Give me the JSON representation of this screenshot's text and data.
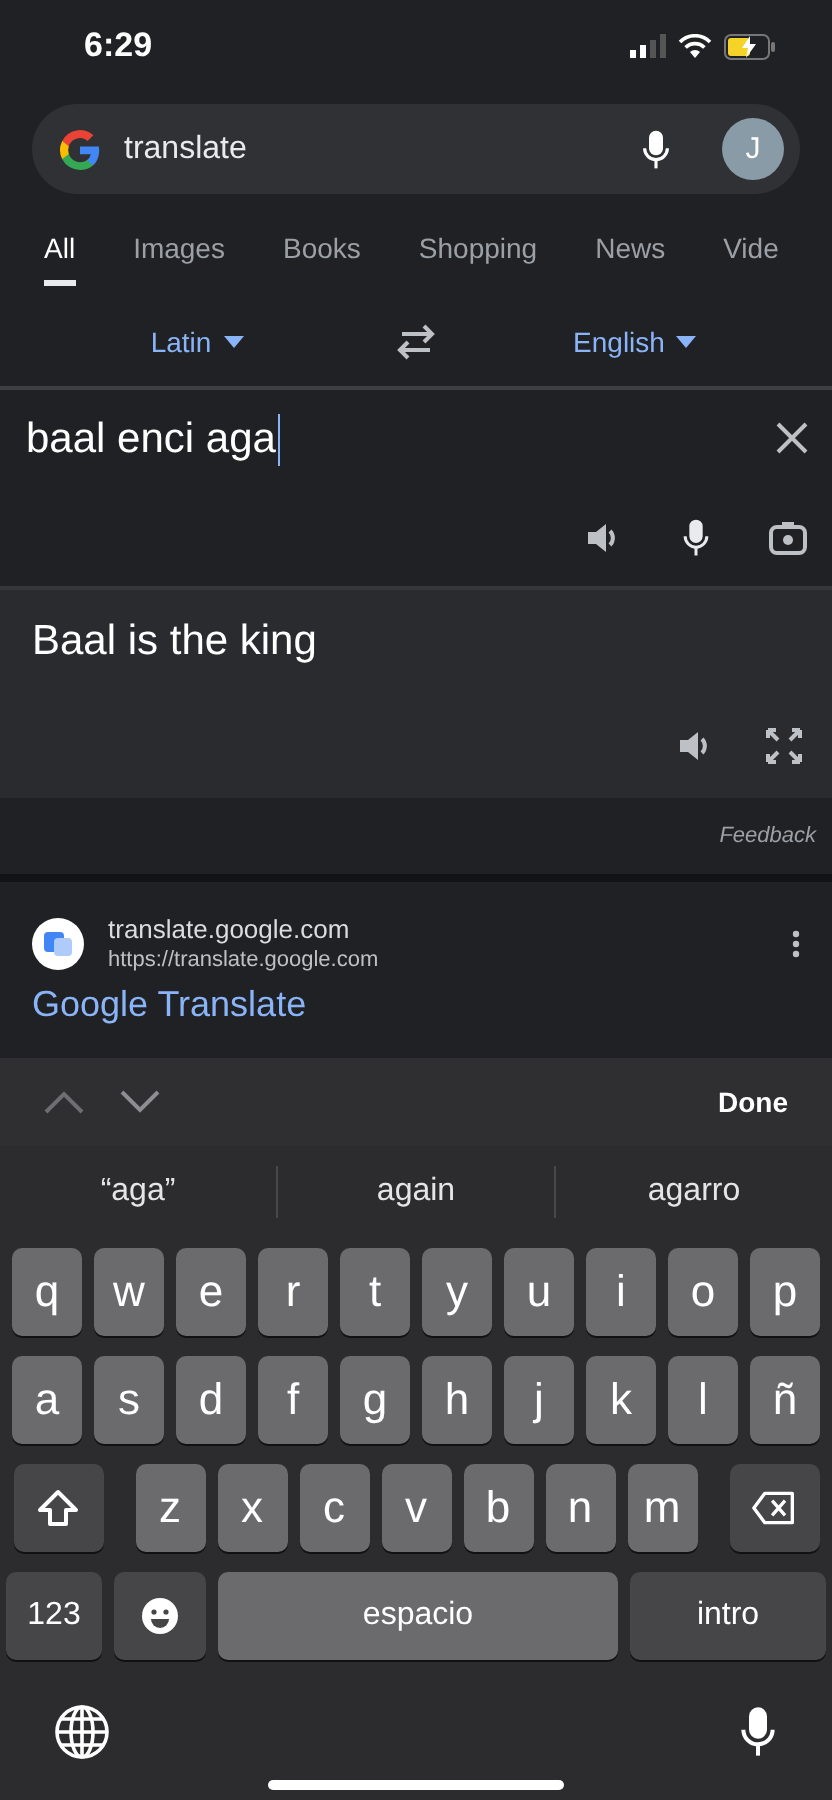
{
  "status_bar": {
    "time": "6:29"
  },
  "search": {
    "query": "translate",
    "avatar_letter": "J"
  },
  "tabs": [
    {
      "label": "All",
      "selected": true
    },
    {
      "label": "Images",
      "selected": false
    },
    {
      "label": "Books",
      "selected": false
    },
    {
      "label": "Shopping",
      "selected": false
    },
    {
      "label": "News",
      "selected": false
    },
    {
      "label": "Vide",
      "selected": false
    }
  ],
  "translator": {
    "source_language": "Latin",
    "target_language": "English",
    "input": "baal enci aga",
    "output": "Baal is the king",
    "feedback": "Feedback"
  },
  "result": {
    "domain": "translate.google.com",
    "url": "https://translate.google.com",
    "title": "Google Translate"
  },
  "keyboard": {
    "done": "Done",
    "suggestions": [
      "“aga”",
      "again",
      "agarro"
    ],
    "rows": [
      [
        {
          "kind": "letter",
          "label": "q"
        },
        {
          "kind": "letter",
          "label": "w"
        },
        {
          "kind": "letter",
          "label": "e"
        },
        {
          "kind": "letter",
          "label": "r"
        },
        {
          "kind": "letter",
          "label": "t"
        },
        {
          "kind": "letter",
          "label": "y"
        },
        {
          "kind": "letter",
          "label": "u"
        },
        {
          "kind": "letter",
          "label": "i"
        },
        {
          "kind": "letter",
          "label": "o"
        },
        {
          "kind": "letter",
          "label": "p"
        }
      ],
      [
        {
          "kind": "letter",
          "label": "a"
        },
        {
          "kind": "letter",
          "label": "s"
        },
        {
          "kind": "letter",
          "label": "d"
        },
        {
          "kind": "letter",
          "label": "f"
        },
        {
          "kind": "letter",
          "label": "g"
        },
        {
          "kind": "letter",
          "label": "h"
        },
        {
          "kind": "letter",
          "label": "j"
        },
        {
          "kind": "letter",
          "label": "k"
        },
        {
          "kind": "letter",
          "label": "l"
        },
        {
          "kind": "letter",
          "label": "ñ"
        }
      ],
      [
        {
          "kind": "shift"
        },
        {
          "kind": "letter",
          "label": "z"
        },
        {
          "kind": "letter",
          "label": "x"
        },
        {
          "kind": "letter",
          "label": "c"
        },
        {
          "kind": "letter",
          "label": "v"
        },
        {
          "kind": "letter",
          "label": "b"
        },
        {
          "kind": "letter",
          "label": "n"
        },
        {
          "kind": "letter",
          "label": "m"
        },
        {
          "kind": "backspace"
        }
      ]
    ],
    "numbers_key": "123",
    "space_key": "espacio",
    "return_key": "intro"
  }
}
